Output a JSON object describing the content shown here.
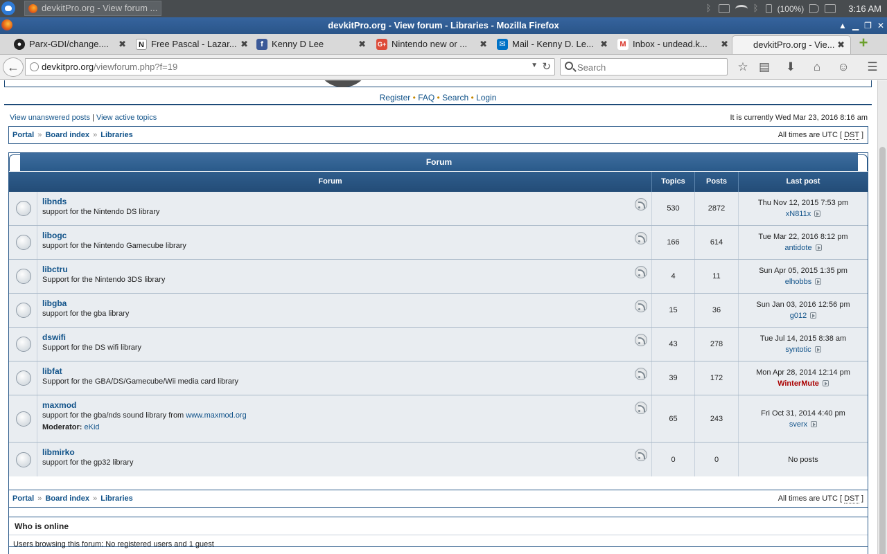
{
  "system_panel": {
    "taskbar_item": "devkitPro.org - View forum ...",
    "battery": "(100%)",
    "clock": "3:16 AM"
  },
  "window": {
    "title": "devkitPro.org - View forum - Libraries - Mozilla Firefox"
  },
  "tabs": [
    {
      "label": "Parx-GDI/change....",
      "icon": "github-icon",
      "color": "#222222"
    },
    {
      "label": "Free Pascal - Lazar...",
      "icon": "n-icon",
      "color": "#111111"
    },
    {
      "label": "Kenny D Lee",
      "icon": "facebook-icon",
      "color": "#3b5998"
    },
    {
      "label": "Nintendo new or ...",
      "icon": "google-plus-icon",
      "color": "#dd4b39"
    },
    {
      "label": "Mail - Kenny D. Le...",
      "icon": "mail-icon",
      "color": "#0072c6"
    },
    {
      "label": "Inbox - undead.k...",
      "icon": "gmail-icon",
      "color": "#d93025"
    },
    {
      "label": "devkitPro.org - Vie...",
      "icon": "",
      "color": ""
    }
  ],
  "navbar": {
    "url_domain": "devkitpro.org",
    "url_path": "/viewforum.php?f=19",
    "search_placeholder": "Search"
  },
  "header_links": {
    "register": "Register",
    "faq": "FAQ",
    "search": "Search",
    "login": "Login",
    "separator": "•"
  },
  "status": {
    "unanswered": "View unanswered posts",
    "pipe": "|",
    "active": "View active topics",
    "current_time": "It is currently Wed Mar 23, 2016 8:16 am"
  },
  "breadcrumb": {
    "portal": "Portal",
    "board_index": "Board index",
    "libraries": "Libraries",
    "sep": "»",
    "tz_prefix": "All times are UTC [",
    "tz_abbr": "DST",
    "tz_suffix": "]"
  },
  "forum_table": {
    "header": "Forum",
    "columns": {
      "forum": "Forum",
      "topics": "Topics",
      "posts": "Posts",
      "last_post": "Last post"
    },
    "rows": [
      {
        "title": "libnds",
        "desc": "support for the Nintendo DS library",
        "topics": "530",
        "posts": "2872",
        "last_date": "Thu Nov 12, 2015 7:53 pm",
        "last_by": "xN811x"
      },
      {
        "title": "libogc",
        "desc": "support for the Nintendo Gamecube library",
        "topics": "166",
        "posts": "614",
        "last_date": "Tue Mar 22, 2016 8:12 pm",
        "last_by": "antidote"
      },
      {
        "title": "libctru",
        "desc": "Support for the Nintendo 3DS library",
        "topics": "4",
        "posts": "11",
        "last_date": "Sun Apr 05, 2015 1:35 pm",
        "last_by": "elhobbs"
      },
      {
        "title": "libgba",
        "desc": "support for the gba library",
        "topics": "15",
        "posts": "36",
        "last_date": "Sun Jan 03, 2016 12:56 pm",
        "last_by": "g012"
      },
      {
        "title": "dswifi",
        "desc": "Support for the DS wifi library",
        "topics": "43",
        "posts": "278",
        "last_date": "Tue Jul 14, 2015 8:38 am",
        "last_by": "syntotic"
      },
      {
        "title": "libfat",
        "desc": "Support for the GBA/DS/Gamecube/Wii media card library",
        "topics": "39",
        "posts": "172",
        "last_date": "Mon Apr 28, 2014 12:14 pm",
        "last_by": "WinterMute"
      },
      {
        "title": "maxmod",
        "desc": "support for the gba/nds sound library from",
        "desc_link": "www.maxmod.org",
        "moderator_label": "Moderator:",
        "moderator": "eKid",
        "topics": "65",
        "posts": "243",
        "last_date": "Fri Oct 31, 2014 4:40 pm",
        "last_by": "sverx"
      },
      {
        "title": "libmirko",
        "desc": "support for the gp32 library",
        "topics": "0",
        "posts": "0",
        "no_posts": "No posts"
      }
    ]
  },
  "who_is_online": {
    "title": "Who is online",
    "text": "Users browsing this forum: No registered users and 1 guest"
  },
  "colors": {
    "link": "#105289",
    "header_blue": "#2a5a8a",
    "row_bg": "#e9edf1",
    "admin_red": "#aa0000"
  }
}
